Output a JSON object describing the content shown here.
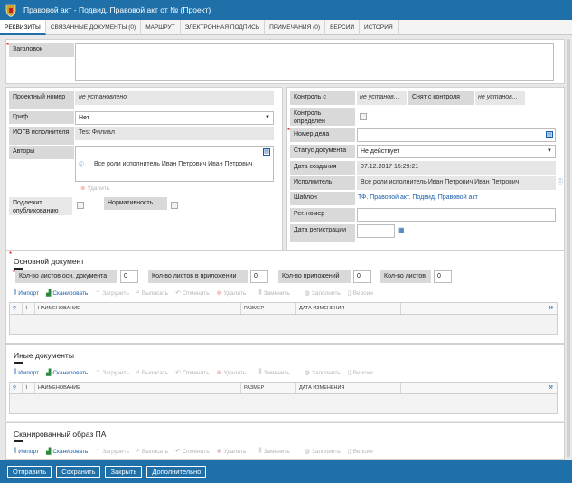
{
  "window": {
    "title": "Правовой акт - Подвид. Правовой акт от № (Проект)"
  },
  "tabs": [
    "РЕКВИЗИТЫ",
    "СВЯЗАННЫЕ ДОКУМЕНТЫ (0)",
    "МАРШРУТ",
    "ЭЛЕКТРОННАЯ ПОДПИСЬ",
    "ПРИМЕЧАНИЯ (0)",
    "ВЕРСИИ",
    "ИСТОРИЯ"
  ],
  "header": {
    "title_label": "Заголовок"
  },
  "left": {
    "project_number_label": "Проектный номер",
    "project_number_value": "не установлено",
    "grif_label": "Гриф",
    "grif_value": "Нет",
    "iogv_label": "ИОГВ исполнителя",
    "iogv_value": "Test Филиал",
    "authors_label": "Авторы",
    "authors_value": "Все роли исполнитель Иван Петрович Иван Петрович",
    "delete_label": "Удалить",
    "publish_label": "Подлежит опубликованию",
    "normative_label": "Нормативность"
  },
  "right": {
    "control_label": "Контроль с",
    "control_value": "не установ...",
    "removed_label": "Снят с контроля",
    "removed_value": "не установ...",
    "control_defined_label": "Контроль определен",
    "case_number_label": "Номер дела",
    "status_label": "Статус документа",
    "status_value": "Не действует",
    "created_label": "Дата создания",
    "created_value": "07.12.2017 15:29:21",
    "executor_label": "Исполнитель",
    "executor_value": "Все роли исполнитель Иван Петрович Иван Петрович",
    "template_label": "Шаблон",
    "template_value": "ТФ. Правовой акт. Подвид. Правовой акт",
    "reg_number_label": "Рег. номер",
    "reg_date_label": "Дата регистрации"
  },
  "main_doc": {
    "title": "Основной документ",
    "sheets_main_label": "Кол-во листов осн. документа",
    "sheets_main_value": "0",
    "sheets_app_label": "Кол-во листов в приложении",
    "sheets_app_value": "0",
    "apps_label": "Кол-во приложений",
    "apps_value": "0",
    "sheets_label": "Кол-во листов",
    "sheets_value": "0"
  },
  "toolbar": {
    "import": "Импорт",
    "scan": "Сканировать",
    "upload": "Загрузить",
    "checkout": "Выписать",
    "cancel": "Отменить",
    "delete": "Удалить",
    "replace": "Заменить",
    "fill": "Заполнить",
    "versions": "Версии"
  },
  "grid": {
    "columns": [
      "НАИМЕНОВАНИЕ",
      "РАЗМЕР",
      "ДАТА ИЗМЕНЕНИЯ"
    ]
  },
  "other_docs": {
    "title": "Иные документы"
  },
  "scanned": {
    "title": "Сканированный образ ПА"
  },
  "buttons": {
    "send": "Отправить",
    "save": "Сохранить",
    "close": "Закрыть",
    "more": "Дополнительно"
  }
}
